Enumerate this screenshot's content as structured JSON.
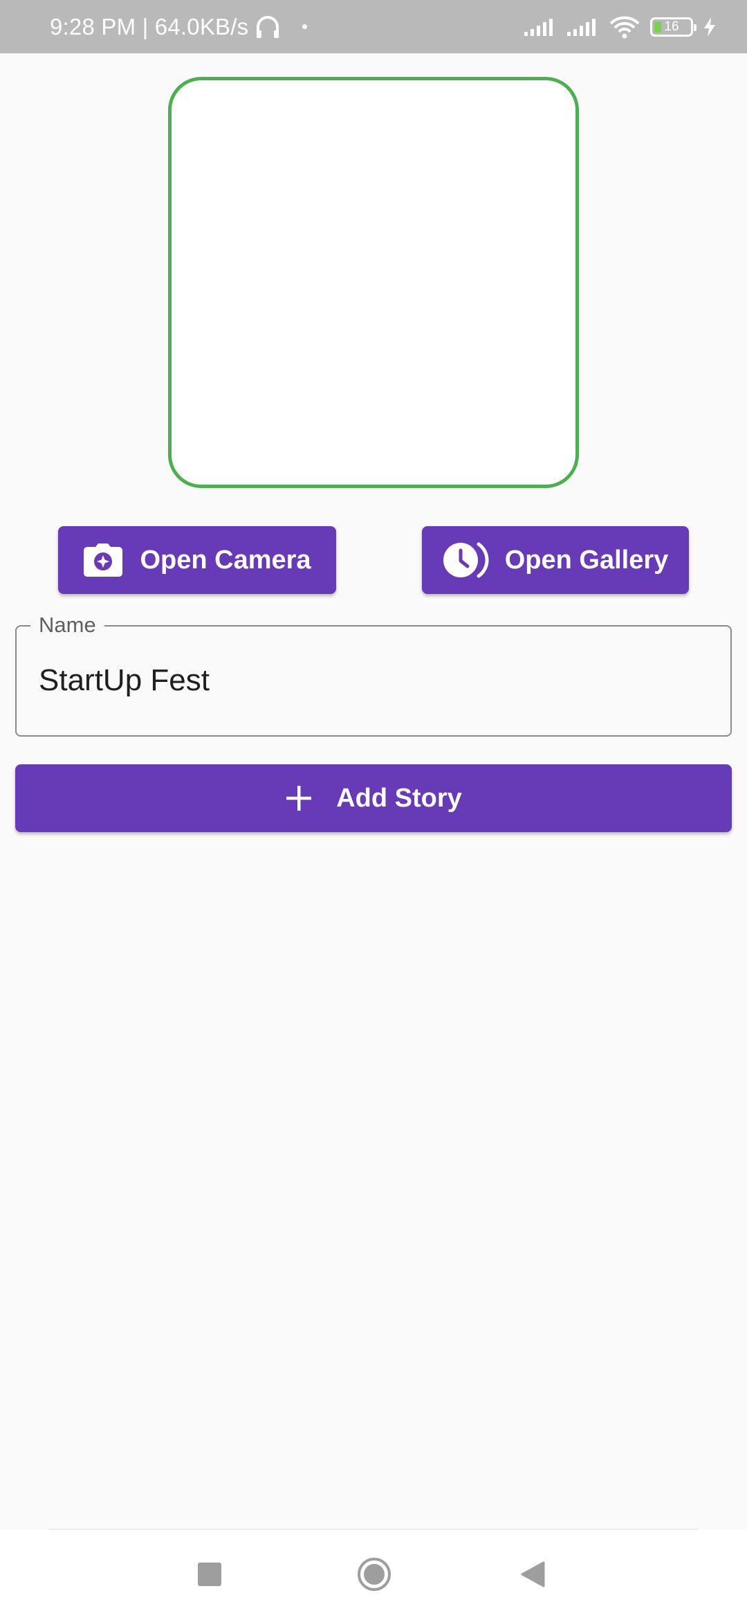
{
  "status_bar": {
    "time_speed": "9:28 PM | 64.0KB/s",
    "battery_level": "16",
    "icons": [
      "headphones-icon",
      "signal-icon",
      "signal-icon",
      "wifi-icon",
      "battery-icon",
      "charging-icon"
    ]
  },
  "buttons": {
    "open_camera": "Open Camera",
    "open_gallery": "Open Gallery",
    "add_story": "Add Story"
  },
  "name_field": {
    "label": "Name",
    "value": "StartUp Fest"
  },
  "colors": {
    "accent": "#673ab7",
    "preview_border": "#4caf50",
    "background": "#fafafa",
    "status_bar": "#b9b9b9"
  },
  "navigation": {
    "icons": [
      "recents-square-icon",
      "home-circle-icon",
      "back-triangle-icon"
    ]
  }
}
